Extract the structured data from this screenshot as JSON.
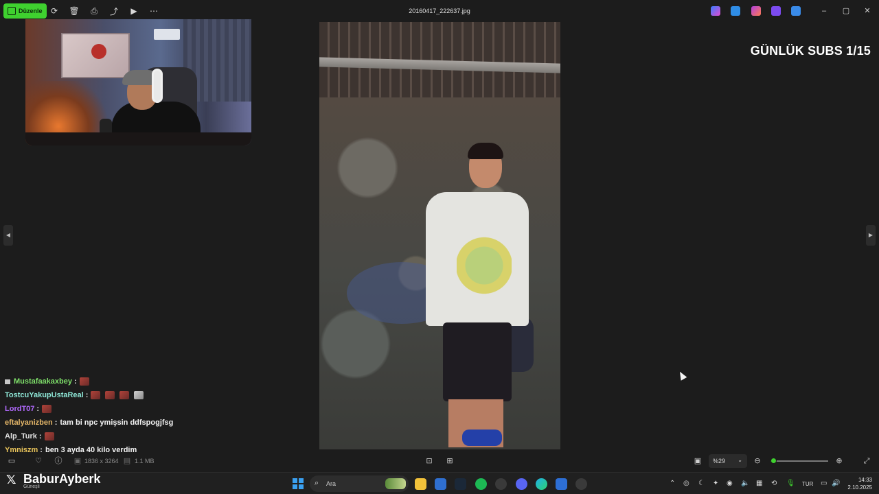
{
  "titlebar": {
    "edit_label": "Düzenle",
    "filename": "20160417_222637.jpg",
    "colors": {
      "edit_bg": "#3fd12f"
    }
  },
  "overlay": {
    "title": "GÜNLÜK SUBS 1/15"
  },
  "chat": {
    "messages": [
      {
        "user": "Mustafaakaxbey",
        "color": "#7fe06a",
        "text": "",
        "emotes": 1
      },
      {
        "user": "TostcuYakupUstaReal",
        "color": "#8fe8d8",
        "text": "",
        "emotes": 4
      },
      {
        "user": "LordT07",
        "color": "#b26aff",
        "text": "",
        "emotes": 1
      },
      {
        "user": "eftalyanizben",
        "color": "#e8b96a",
        "text": "tam bi npc ymişsin ddfspogjfsg",
        "emotes": 0
      },
      {
        "user": "Alp_Turk",
        "color": "#e0e0e0",
        "text": "",
        "emotes": 1
      },
      {
        "user": "Ymniszm",
        "color": "#e8c35a",
        "text": "ben 3 ayda 40 kilo verdim",
        "emotes": 0
      }
    ],
    "separator": ":"
  },
  "bottombar": {
    "dimensions": "1836 x 3264",
    "filesize": "1.1 MB",
    "zoom_label": "%29",
    "zoom_fraction": 0.05
  },
  "taskbar": {
    "brand": "BaburAyberk",
    "brand_sub": "Güneşli",
    "search_placeholder": "Ara",
    "language": "TUR",
    "time": "14:33",
    "date": "2.10.2025"
  }
}
